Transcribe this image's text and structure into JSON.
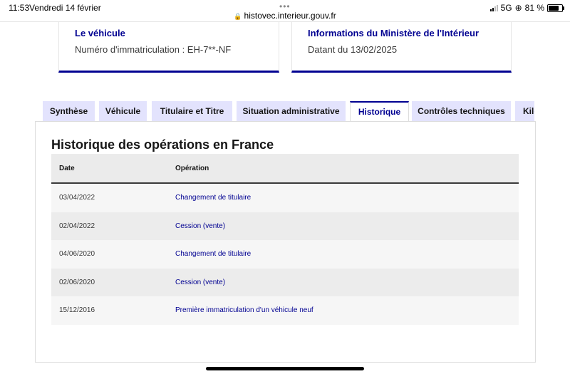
{
  "status_bar": {
    "time": "11:53",
    "date": "Vendredi 14 février",
    "url": "histovec.interieur.gouv.fr",
    "network": "5G",
    "battery": "81 %",
    "battery_level": 0.81
  },
  "cards": [
    {
      "title": "Le véhicule",
      "description": "Numéro d'immatriculation : EH-7**-NF"
    },
    {
      "title": "Informations du Ministère de l'Intérieur",
      "description": "Datant du 13/02/2025"
    }
  ],
  "tabs": [
    {
      "label": "Synthèse",
      "active": false
    },
    {
      "label": "Véhicule",
      "active": false
    },
    {
      "label": "Titulaire et Titre",
      "active": false
    },
    {
      "label": "Situation administrative",
      "active": false
    },
    {
      "label": "Historique",
      "active": true
    },
    {
      "label": "Contrôles techniques",
      "active": false
    },
    {
      "label": "Kilométrage",
      "active": false
    }
  ],
  "history": {
    "title": "Historique des opérations en France",
    "columns": [
      "Date",
      "Opération"
    ],
    "rows": [
      {
        "date": "03/04/2022",
        "operation": "Changement de titulaire"
      },
      {
        "date": "02/04/2022",
        "operation": "Cession (vente)"
      },
      {
        "date": "04/06/2020",
        "operation": "Changement de titulaire"
      },
      {
        "date": "02/06/2020",
        "operation": "Cession (vente)"
      },
      {
        "date": "15/12/2016",
        "operation": "Première immatriculation d'un véhicule neuf"
      }
    ]
  },
  "colors": {
    "accent": "#000091",
    "tab_background": "#e3e3fd",
    "table_header": "#ebebeb"
  }
}
